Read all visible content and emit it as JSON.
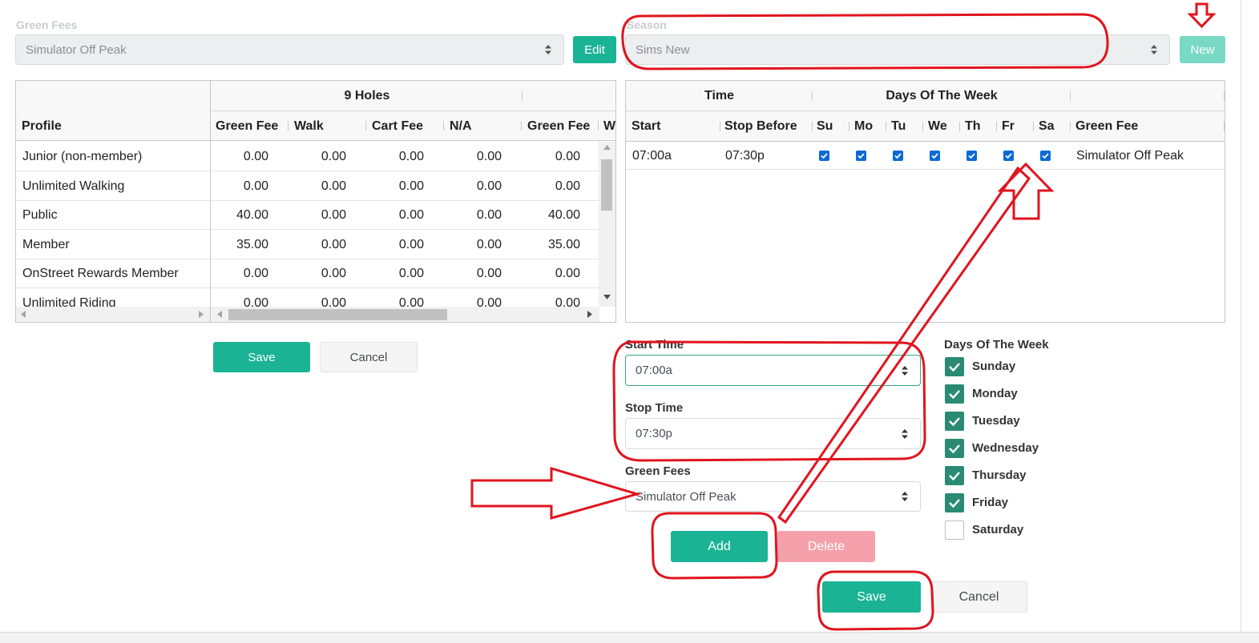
{
  "top": {
    "green_fees_label": "Green Fees",
    "green_fees_value": "Simulator Off Peak",
    "edit_label": "Edit",
    "season_label": "Season",
    "season_value": "Sims New",
    "new_label": "New"
  },
  "fee_grid": {
    "group_header": "9 Holes",
    "columns": [
      "Profile",
      "Green Fee",
      "Walk",
      "Cart Fee",
      "N/A",
      "Green Fee",
      "W"
    ],
    "rows": [
      {
        "profile": "Junior (non-member)",
        "values": [
          "0.00",
          "0.00",
          "0.00",
          "0.00",
          "0.00"
        ]
      },
      {
        "profile": "Unlimited Walking",
        "values": [
          "0.00",
          "0.00",
          "0.00",
          "0.00",
          "0.00"
        ]
      },
      {
        "profile": "Public",
        "values": [
          "40.00",
          "0.00",
          "0.00",
          "0.00",
          "40.00"
        ]
      },
      {
        "profile": "Member",
        "values": [
          "35.00",
          "0.00",
          "0.00",
          "0.00",
          "35.00"
        ]
      },
      {
        "profile": "OnStreet Rewards Member",
        "values": [
          "0.00",
          "0.00",
          "0.00",
          "0.00",
          "0.00"
        ]
      },
      {
        "profile": "Unlimited Riding",
        "values": [
          "0.00",
          "0.00",
          "0.00",
          "0.00",
          "0.00"
        ]
      }
    ],
    "save_label": "Save",
    "cancel_label": "Cancel"
  },
  "schedule_grid": {
    "time_header": "Time",
    "days_header": "Days Of The Week",
    "columns": [
      "Start",
      "Stop Before",
      "Su",
      "Mo",
      "Tu",
      "We",
      "Th",
      "Fr",
      "Sa",
      "Green Fee"
    ],
    "rows": [
      {
        "start": "07:00a",
        "stop": "07:30p",
        "days": [
          true,
          true,
          true,
          true,
          true,
          true,
          true
        ],
        "green_fee": "Simulator Off Peak"
      }
    ]
  },
  "form": {
    "start_time_label": "Start Time",
    "start_time_value": "07:00a",
    "stop_time_label": "Stop Time",
    "stop_time_value": "07:30p",
    "green_fees_label": "Green Fees",
    "green_fees_value": "Simulator Off Peak",
    "add_label": "Add",
    "delete_label": "Delete",
    "save_label": "Save",
    "cancel_label": "Cancel",
    "days_label": "Days Of The Week",
    "days": [
      {
        "name": "Sunday",
        "checked": true
      },
      {
        "name": "Monday",
        "checked": true
      },
      {
        "name": "Tuesday",
        "checked": true
      },
      {
        "name": "Wednesday",
        "checked": true
      },
      {
        "name": "Thursday",
        "checked": true
      },
      {
        "name": "Friday",
        "checked": true
      },
      {
        "name": "Saturday",
        "checked": false
      }
    ]
  },
  "colors": {
    "accent": "#1ab394",
    "annotation": "#e0141e",
    "checkbox_blue": "#0a6ad6",
    "checkbox_green": "#2b8a73"
  }
}
